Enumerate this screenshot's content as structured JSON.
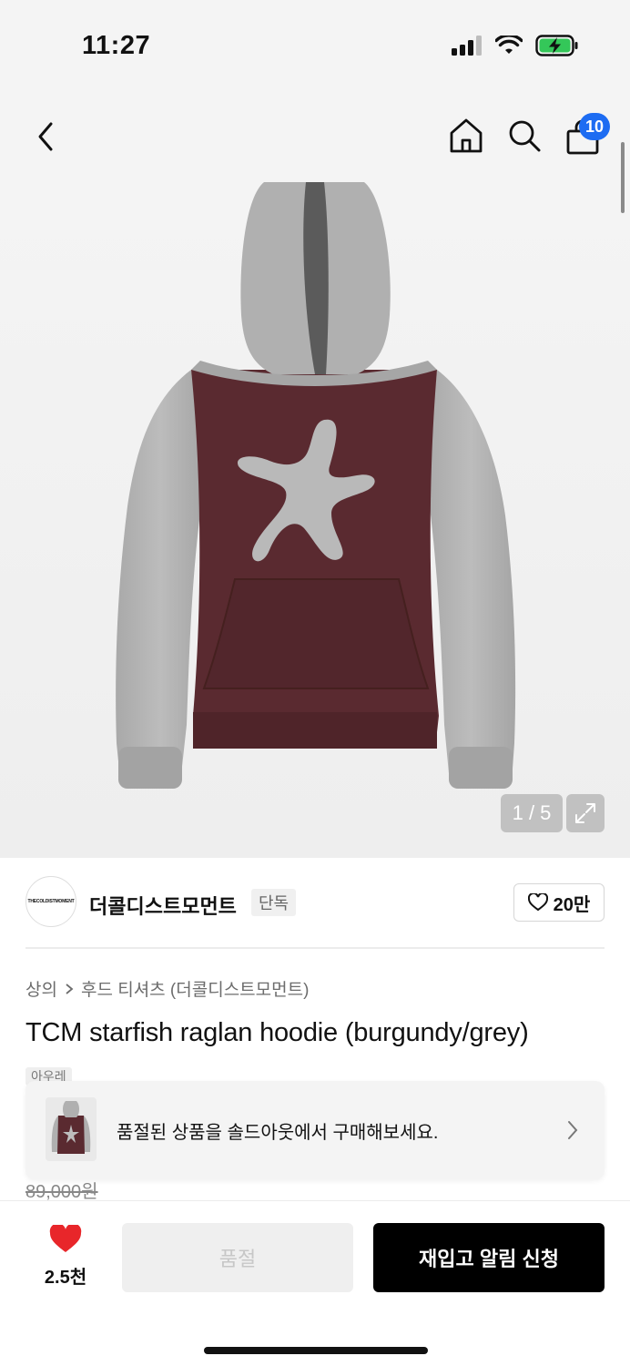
{
  "status": {
    "time": "11:27"
  },
  "nav": {
    "cart_count": "10"
  },
  "gallery": {
    "counter": "1 / 5"
  },
  "brand": {
    "logo_text": "THECOLDISTMOMENT",
    "name": "더콜디스트모먼트",
    "tag": "단독",
    "likes": "20만"
  },
  "breadcrumb": {
    "category": "상의",
    "subcategory": "후드 티셔츠 (더콜디스트모먼트)"
  },
  "product": {
    "title": "TCM starfish raglan hoodie (burgundy/grey)",
    "hidden_tag": "아우레",
    "original_price": "89,000원"
  },
  "banner": {
    "text": "품절된 상품을 솔드아웃에서 구매해보세요."
  },
  "bottom": {
    "wish_count": "2.5천",
    "soldout_label": "품절",
    "restock_label": "재입고 알림 신청"
  },
  "colors": {
    "accent_blue": "#1d6cf2",
    "heart_red": "#e8262a",
    "burgundy": "#5a2a30",
    "grey": "#b3b3b3"
  },
  "icons": [
    "back-icon",
    "home-icon",
    "search-icon",
    "cart-icon",
    "expand-icon",
    "heart-icon",
    "chevron-right-icon"
  ]
}
